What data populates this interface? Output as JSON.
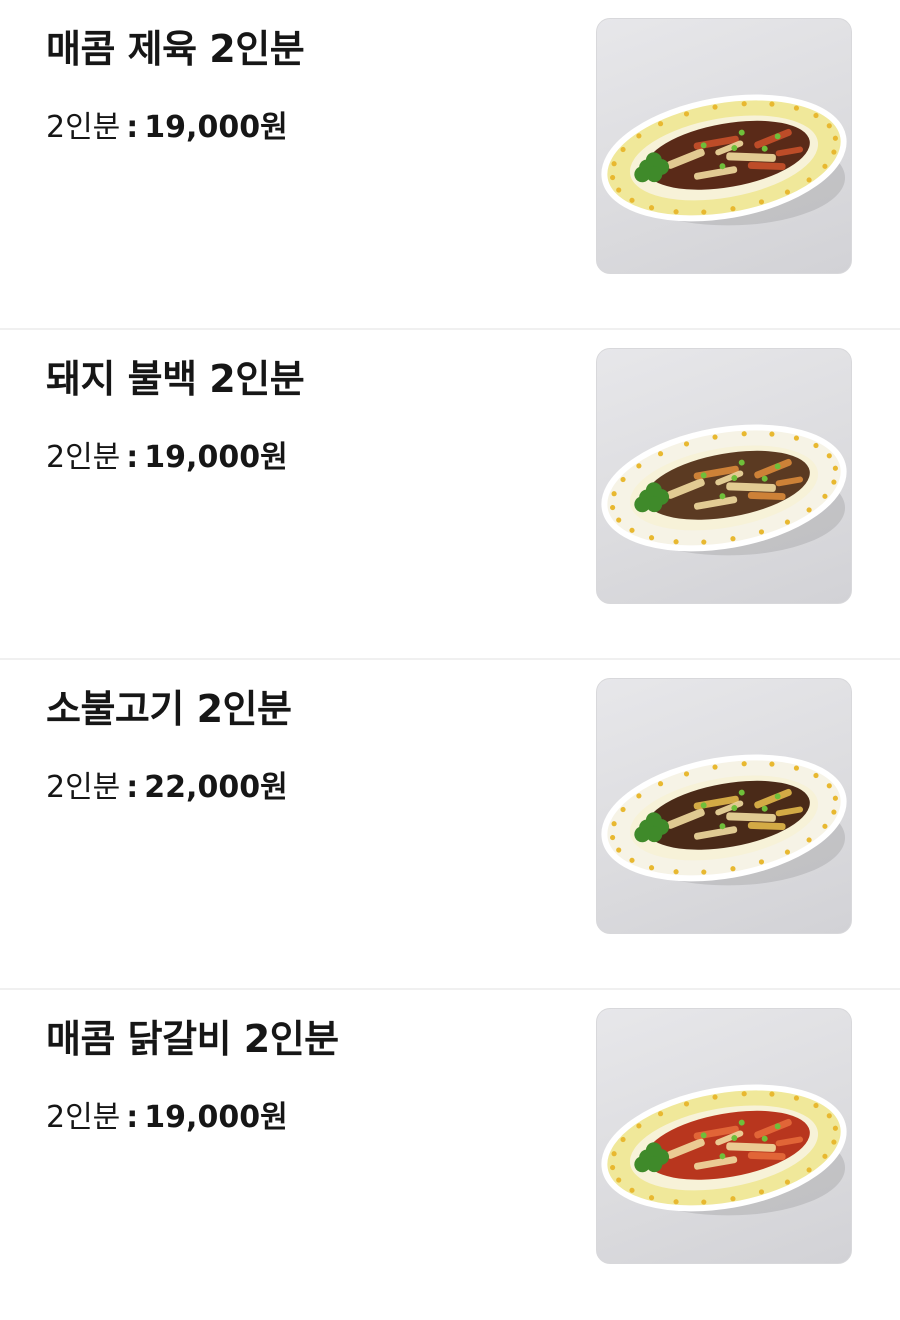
{
  "menu": {
    "items": [
      {
        "name": "매콤 제육 2인분",
        "price_label": "2인분",
        "price_separator": ":",
        "price": "19,000원",
        "image": {
          "alt": "매콤 제육 2인분",
          "plate_rim": "#f0e89a",
          "food_base": "#5a2a18",
          "food_accent": "#c8502a",
          "garnish": "#3f8a2a"
        }
      },
      {
        "name": "돼지 불백 2인분",
        "price_label": "2인분",
        "price_separator": ":",
        "price": "19,000원",
        "image": {
          "alt": "돼지 불백 2인분",
          "plate_rim": "#f6f3e6",
          "food_base": "#5b3a22",
          "food_accent": "#d98a3a",
          "garnish": "#3f8a2a"
        }
      },
      {
        "name": "소불고기 2인분",
        "price_label": "2인분",
        "price_separator": ":",
        "price": "22,000원",
        "image": {
          "alt": "소불고기 2인분",
          "plate_rim": "#f6f3e6",
          "food_base": "#4a2a18",
          "food_accent": "#e2b84a",
          "garnish": "#3f8a2a"
        }
      },
      {
        "name": "매콤 닭갈비 2인분",
        "price_label": "2인분",
        "price_separator": ":",
        "price": "19,000원",
        "image": {
          "alt": "매콤 닭갈비 2인분",
          "plate_rim": "#f0e89a",
          "food_base": "#b8361e",
          "food_accent": "#e56a3a",
          "garnish": "#3f8a2a"
        }
      }
    ]
  }
}
